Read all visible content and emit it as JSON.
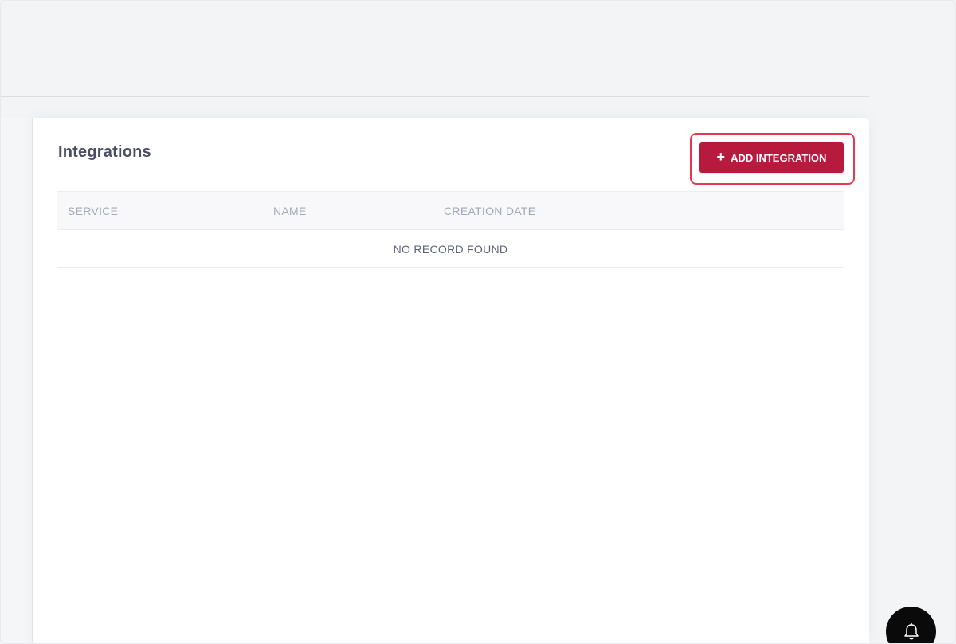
{
  "card": {
    "title": "Integrations",
    "add_button_label": "ADD INTEGRATION",
    "add_button_icon": "plus-icon"
  },
  "table": {
    "columns": [
      "SERVICE",
      "NAME",
      "CREATION DATE"
    ],
    "empty_message": "NO RECORD FOUND"
  },
  "fab": {
    "icon": "bell-icon"
  },
  "colors": {
    "primary_button": "#b81a3e",
    "highlight_ring": "#e8384f",
    "page_background": "#f3f4f6",
    "card_background": "#ffffff"
  }
}
